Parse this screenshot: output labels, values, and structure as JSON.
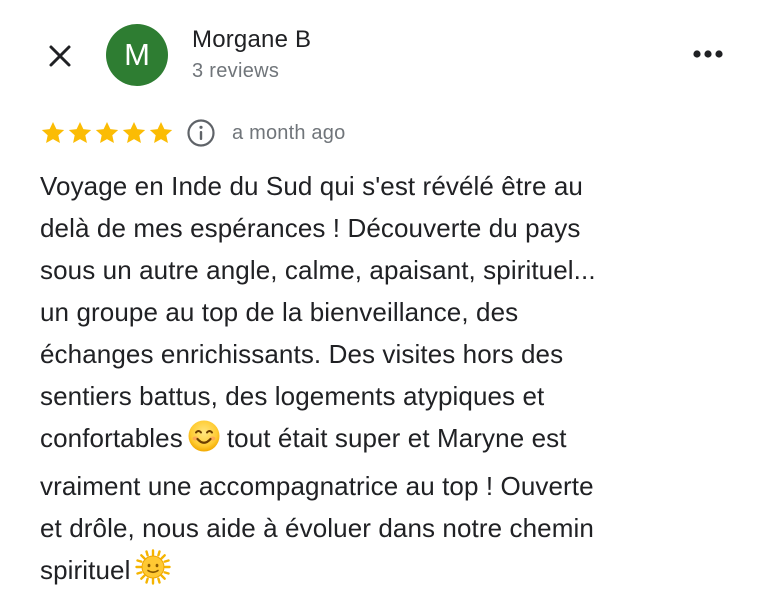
{
  "header": {
    "avatar_letter": "M",
    "avatar_color": "#2E7D32",
    "reviewer_name": "Morgane B",
    "reviewer_subtitle": "3 reviews",
    "close_icon": "close-icon",
    "more_icon": "more-horizontal-icon"
  },
  "rating": {
    "stars": 5,
    "max_stars": 5,
    "star_color": "#FBBC04",
    "date": "a month ago",
    "info_icon": "info-icon"
  },
  "review": {
    "lines": [
      "Voyage en Inde du Sud qui s'est révélé être au",
      "delà de mes espérances ! Découverte du pays",
      "sous un autre angle, calme, apaisant, spirituel...",
      "un groupe au top de la bienveillance, des",
      "échanges enrichissants. Des visites hors des",
      "sentiers battus, des logements atypiques et",
      "confortables",
      "tout était super et Maryne est",
      "vraiment une accompagnatrice au top ! Ouverte",
      "et drôle, nous aide à évoluer dans notre chemin",
      "spirituel"
    ],
    "emojis": [
      "smiling-face-emoji",
      "sun-with-face-emoji"
    ]
  }
}
